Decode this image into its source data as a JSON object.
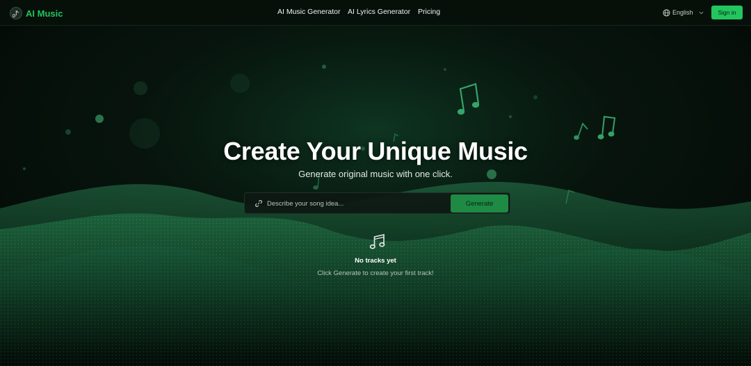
{
  "brand": {
    "name": "AI Music",
    "accent": "#22c55e"
  },
  "nav": {
    "items": [
      "AI Music Generator",
      "AI Lyrics Generator",
      "Pricing"
    ]
  },
  "language": {
    "selected": "English",
    "icon": "globe-icon"
  },
  "auth": {
    "signin_label": "Sign in"
  },
  "hero": {
    "title": "Create Your Unique Music",
    "subtitle": "Generate original music with one click."
  },
  "prompt": {
    "placeholder": "Describe your song idea...",
    "value": "",
    "icon": "link-icon",
    "generate_label": "Generate"
  },
  "tracks": {
    "empty_icon": "music-notes-icon",
    "empty_title": "No tracks yet",
    "empty_hint": "Click Generate to create your first track!"
  }
}
